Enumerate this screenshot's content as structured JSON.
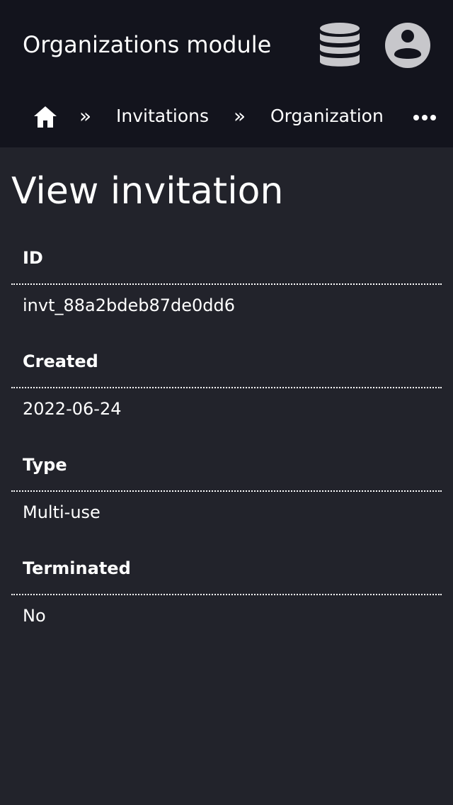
{
  "header": {
    "title": "Organizations module",
    "database_icon": "database-icon",
    "account_icon": "account-circle-icon"
  },
  "breadcrumb": {
    "home_icon": "home-icon",
    "separator": "»",
    "items": [
      {
        "label": "Invitations"
      },
      {
        "label": "Organization"
      }
    ],
    "more_icon": "more-horizontal-icon"
  },
  "page": {
    "title": "View invitation"
  },
  "details": [
    {
      "label": "ID",
      "value": "invt_88a2bdeb87de0dd6"
    },
    {
      "label": "Created",
      "value": "2022-06-24"
    },
    {
      "label": "Type",
      "value": "Multi-use"
    },
    {
      "label": "Terminated",
      "value": "No"
    }
  ],
  "colors": {
    "header_background": "#13141d",
    "page_background": "#22232b",
    "icon_gray": "#c7c7cb",
    "text": "#ffffff"
  }
}
